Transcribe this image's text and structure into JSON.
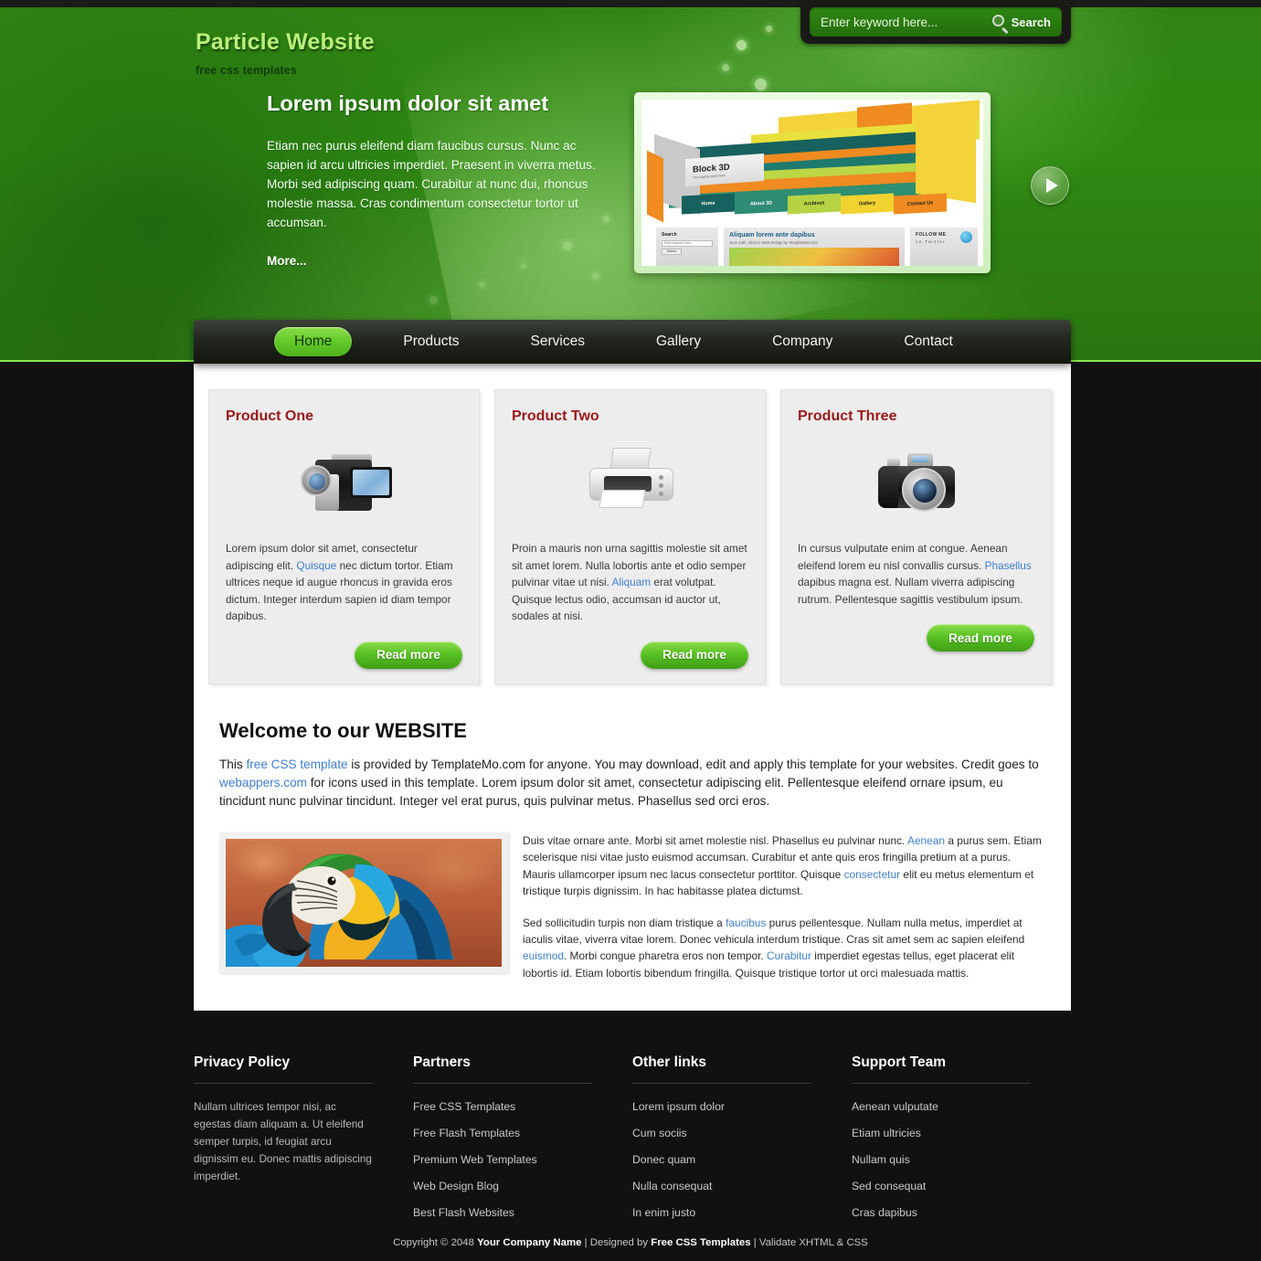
{
  "site": {
    "brand_title": "Particle Website",
    "brand_subtitle": "free css templates"
  },
  "search": {
    "placeholder": "Enter keyword here...",
    "button_label": "Search",
    "value": ""
  },
  "hero": {
    "title": "Lorem ipsum dolor sit amet",
    "body": "Etiam nec purus eleifend diam faucibus cursus. Nunc ac sapien id arcu ultricies imperdiet. Praesent in viverra metus. Morbi sed adipiscing quam. Curabitur at nunc dui, rhoncus molestie massa. Cras condimentum consectetur tortor ut accumsan.",
    "more_label": "More...",
    "slide": {
      "logo_title": "Block 3D",
      "logo_tagline": "Your tagline goes here",
      "nav": [
        "Home",
        "About 3D",
        "Archives",
        "Gallery",
        "Contact Us"
      ],
      "search_label": "Search",
      "search_placeholder": "Enter keyword here...",
      "search_button": "Search",
      "post_title": "Aliquam lorem ante dapibus",
      "post_meta": "June 24th, 2024 in Web Design by TemplateMo.com",
      "follow_line1": "FOLLOW ME",
      "follow_line2": "on Twitter"
    }
  },
  "nav": {
    "items": [
      {
        "label": "Home",
        "active": true
      },
      {
        "label": "Products",
        "active": false
      },
      {
        "label": "Services",
        "active": false
      },
      {
        "label": "Gallery",
        "active": false
      },
      {
        "label": "Company",
        "active": false
      },
      {
        "label": "Contact",
        "active": false
      }
    ]
  },
  "products": [
    {
      "title": "Product One",
      "icon": "camcorder-icon",
      "text_before": "Lorem ipsum dolor sit amet, consectetur adipiscing elit. ",
      "link": "Quisque",
      "text_after": " nec dictum tortor. Etiam ultrices neque id augue rhoncus in gravida eros dictum. Integer interdum sapien id diam tempor dapibus.",
      "button": "Read more"
    },
    {
      "title": "Product Two",
      "icon": "printer-icon",
      "text_before": "Proin a mauris non urna sagittis molestie sit amet sit amet lorem. Nulla lobortis ante et odio semper pulvinar vitae ut nisi. ",
      "link": "Aliquam",
      "text_after": " erat volutpat. Quisque lectus odio, accumsan id auctor ut, sodales at nisi.",
      "button": "Read more"
    },
    {
      "title": "Product Three",
      "icon": "dslr-camera-icon",
      "text_before": "In cursus vulputate enim at congue. Aenean eleifend lorem eu nisl convallis cursus. ",
      "link": "Phasellus",
      "text_after": " dapibus magna est. Nullam viverra adipiscing rutrum. Pellentesque sagittis vestibulum ipsum.",
      "button": "Read more"
    }
  ],
  "welcome": {
    "heading": "Welcome to our WEBSITE",
    "p1_a": "This ",
    "p1_link1": "free CSS template",
    "p1_b": " is provided by TemplateMo.com for anyone. You may download, edit and apply this template for your websites. Credit goes to ",
    "p1_link2": "webappers.com",
    "p1_c": " for icons used in this template. Lorem ipsum dolor sit amet, consectetur adipiscing elit. Pellentesque eleifend ornare ipsum, eu tincidunt nunc pulvinar tincidunt. Integer vel erat purus, quis pulvinar metus. Phasellus sed orci eros."
  },
  "article": {
    "image_alt": "blue-and-gold macaw parrot",
    "p1_a": "Duis vitae ornare ante. Morbi sit amet molestie nisl. Phasellus eu pulvinar nunc. ",
    "p1_link1": "Aenean",
    "p1_b": " a purus sem. Etiam scelerisque nisi vitae justo euismod accumsan. Curabitur et ante quis eros fringilla pretium at a purus. Mauris ullamcorper ipsum nec lacus consectetur porttitor. Quisque ",
    "p1_link2": "consectetur",
    "p1_c": " elit eu metus elementum et tristique turpis dignissim. In hac habitasse platea dictumst.",
    "p2_a": "Sed sollicitudin turpis non diam tristique a ",
    "p2_link1": "faucibus",
    "p2_b": " purus pellentesque. Nullam nulla metus, imperdiet at iaculis vitae, viverra vitae lorem. Donec vehicula interdum tristique. Cras sit amet sem ac sapien eleifend ",
    "p2_link2": "euismod",
    "p2_c": ". Morbi congue pharetra eros non tempor. ",
    "p2_link3": "Curabitur",
    "p2_d": " imperdiet egestas tellus, eget placerat elit lobortis id. Etiam lobortis bibendum fringilla. Quisque tristique tortor ut orci malesuada mattis."
  },
  "footer": {
    "columns": [
      {
        "heading": "Privacy Policy",
        "type": "text",
        "text": "Nullam ultrices tempor nisi, ac egestas diam aliquam a. Ut eleifend semper turpis, id feugiat arcu dignissim eu. Donec mattis adipiscing imperdiet."
      },
      {
        "heading": "Partners",
        "type": "links",
        "links": [
          "Free CSS Templates",
          "Free Flash Templates",
          "Premium Web Templates",
          "Web Design Blog",
          "Best Flash Websites"
        ]
      },
      {
        "heading": "Other links",
        "type": "links",
        "links": [
          "Lorem ipsum dolor",
          "Cum sociis",
          "Donec quam",
          "Nulla consequat",
          "In enim justo"
        ]
      },
      {
        "heading": "Support Team",
        "type": "links",
        "links": [
          "Aenean vulputate",
          "Etiam ultricies",
          "Nullam quis",
          "Sed consequat",
          "Cras dapibus"
        ]
      }
    ],
    "copyright_a": "Copyright © 2048 ",
    "copyright_company": "Your Company Name",
    "copyright_b": " | Designed by ",
    "copyright_designer": "Free CSS Templates",
    "copyright_c": " | Validate XHTML & CSS"
  },
  "colors": {
    "header_green": "#2f8a12",
    "accent_green": "#58c223",
    "nav_dark": "#22261f",
    "page_dark": "#111110",
    "product_title_red": "#9a1818",
    "link_blue": "#3f7fd0"
  }
}
